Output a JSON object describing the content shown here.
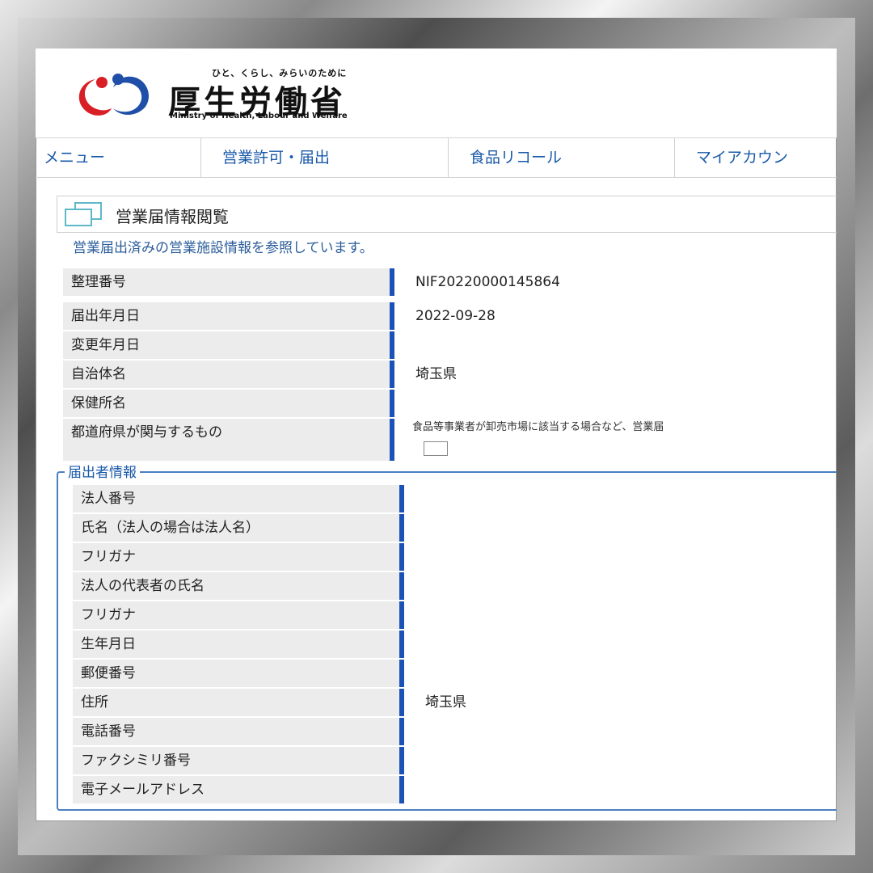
{
  "header": {
    "tagline": "ひと、くらし、みらいのために",
    "ministry_ja": "厚生労働省",
    "ministry_en": "Ministry of Health, Labour and Welfare"
  },
  "nav": [
    "メニュー",
    "営業許可・届出",
    "食品リコール",
    "マイアカウン"
  ],
  "section": {
    "title": "営業届情報閲覧",
    "description": "営業届出済みの営業施設情報を参照しています。"
  },
  "fields": [
    {
      "label": "整理番号",
      "value": "NIF20220000145864"
    },
    {
      "label": "届出年月日",
      "value": "2022-09-28"
    },
    {
      "label": "変更年月日",
      "value": ""
    },
    {
      "label": "自治体名",
      "value": "埼玉県"
    },
    {
      "label": "保健所名",
      "value": ""
    }
  ],
  "prefecture_field": {
    "label": "都道府県が関与するもの",
    "note": "食品等事業者が卸売市場に該当する場合など、営業届"
  },
  "applicant_group": {
    "legend": "届出者情報",
    "fields": [
      {
        "label": "法人番号",
        "value": ""
      },
      {
        "label": "氏名（法人の場合は法人名）",
        "value": ""
      },
      {
        "label": "フリガナ",
        "value": ""
      },
      {
        "label": "法人の代表者の氏名",
        "value": ""
      },
      {
        "label": "フリガナ",
        "value": ""
      },
      {
        "label": "生年月日",
        "value": ""
      },
      {
        "label": "郵便番号",
        "value": ""
      },
      {
        "label": "住所",
        "value": "埼玉県"
      },
      {
        "label": "電話番号",
        "value": ""
      },
      {
        "label": "ファクシミリ番号",
        "value": ""
      },
      {
        "label": "電子メールアドレス",
        "value": ""
      }
    ]
  },
  "colors": {
    "accent": "#1a52b8",
    "link": "#1a5aa8",
    "label_bg": "#ececec"
  }
}
